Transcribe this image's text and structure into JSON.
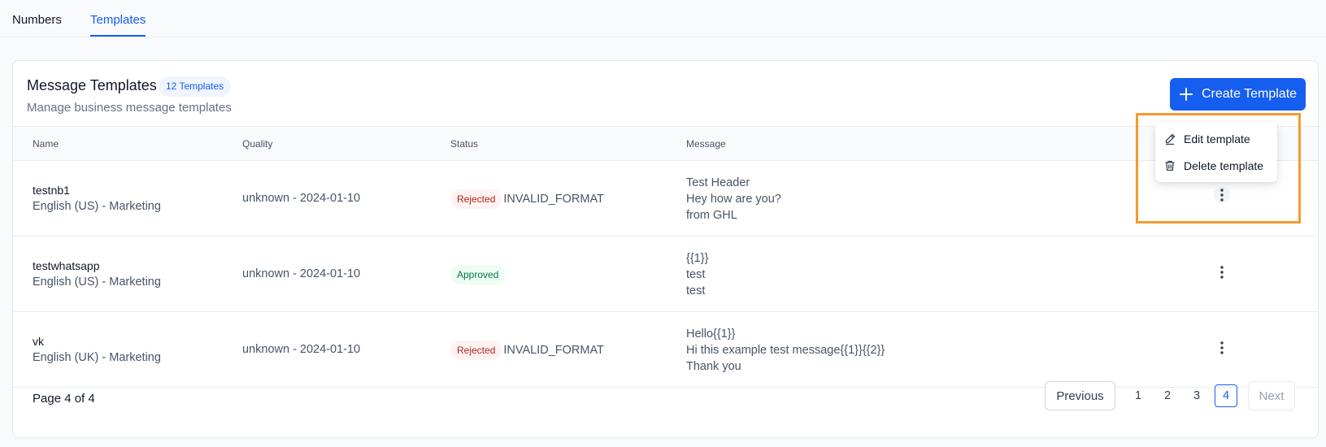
{
  "tabs": [
    {
      "label": "Numbers",
      "active": false
    },
    {
      "label": "Templates",
      "active": true
    }
  ],
  "header": {
    "title": "Message Templates",
    "count_badge": "12 Templates",
    "subtitle": "Manage business message templates",
    "create_button": "Create Template"
  },
  "table": {
    "columns": [
      "Name",
      "Quality",
      "Status",
      "Message"
    ],
    "rows": [
      {
        "name": "testnb1",
        "sub": "English (US) - Marketing",
        "quality": "unknown - 2024-01-10",
        "status": "Rejected",
        "reason": "INVALID_FORMAT",
        "message": [
          "Test Header",
          "Hey how are you?",
          "from GHL"
        ]
      },
      {
        "name": "testwhatsapp",
        "sub": "English (US) - Marketing",
        "quality": "unknown - 2024-01-10",
        "status": "Approved",
        "reason": "",
        "message": [
          "{{1}}",
          "test",
          "test"
        ]
      },
      {
        "name": "vk",
        "sub": "English (UK) - Marketing",
        "quality": "unknown - 2024-01-10",
        "status": "Rejected",
        "reason": "INVALID_FORMAT",
        "message": [
          "Hello{{1}}",
          "Hi this example test message{{1}}{{2}}",
          "Thank you"
        ]
      }
    ]
  },
  "dropdown": {
    "items": [
      "Edit template",
      "Delete template"
    ]
  },
  "pagination": {
    "page_info": "Page 4 of 4",
    "previous": "Previous",
    "pages": [
      "1",
      "2",
      "3",
      "4"
    ],
    "current": "4",
    "next": "Next"
  },
  "colors": {
    "accent": "#155eef",
    "highlight": "#f59a2c",
    "rejected": "#b42318",
    "approved": "#067647"
  }
}
